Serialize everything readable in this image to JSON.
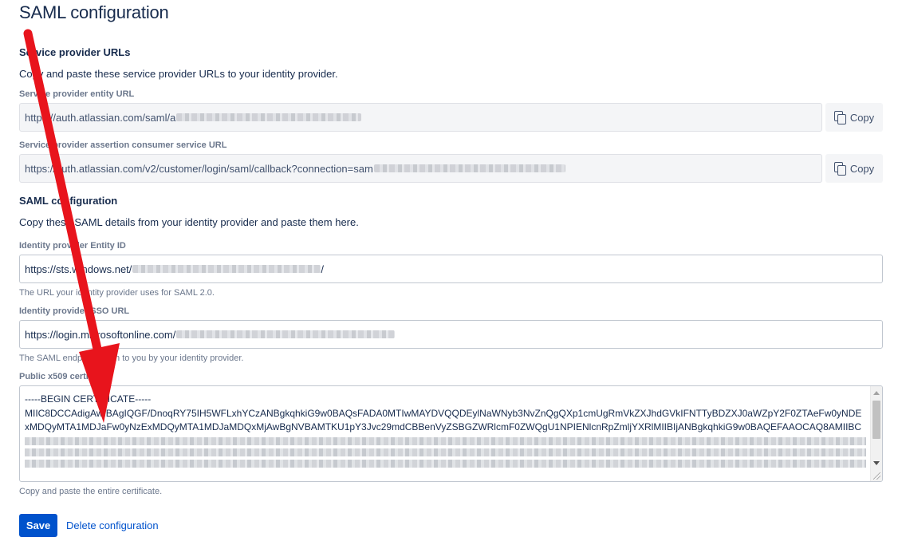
{
  "page": {
    "title": "SAML configuration"
  },
  "service_provider": {
    "heading": "Service provider URLs",
    "description": "Copy and paste these service provider URLs to your identity provider.",
    "entity_url": {
      "label": "Service provider entity URL",
      "value": "https://auth.atlassian.com/saml/a",
      "copy_label": "Copy"
    },
    "acs_url": {
      "label": "Service provider assertion consumer service URL",
      "value": "https://auth.atlassian.com/v2/customer/login/saml/callback?connection=sam",
      "copy_label": "Copy"
    }
  },
  "saml": {
    "heading": "SAML configuration",
    "description": "Copy these SAML details from your identity provider and paste them here.",
    "entity_id": {
      "label": "Identity provider Entity ID",
      "value": "https://sts.windows.net/",
      "suffix": "/",
      "helper": "The URL your identity provider uses for SAML 2.0."
    },
    "sso_url": {
      "label": "Identity provider SSO URL",
      "value": "https://login.microsoftonline.com/",
      "helper": "The SAML endpoint given to you by your identity provider."
    },
    "certificate": {
      "label": "Public x509 certificate",
      "lines": [
        "-----BEGIN CERTIFICATE-----",
        "MIIC8DCCAdigAwIBAgIQGF/DnoqRY75IH5WFLxhYCzANBgkqhkiG9w0BAQsFADA0MTIwMAYDVQQDEylNaWNyb3NvZnQgQXp1cmUgRmVkZXJhdGVkIFNTTyBDZXJ0aWZpY2F0ZTAeFw0yNDE",
        "xMDQyMTA1MDJaFw0yNzExMDQyMTA1MDJaMDQxMjAwBgNVBAMTKU1pY3Jvc29mdCBBenVyZSBGZWRlcmF0ZWQgU1NPIENlcnRpZmljYXRlMIIBIjANBgkqhkiG9w0BAQEFAAOCAQ8AMIIBC"
      ],
      "helper": "Copy and paste the entire certificate."
    }
  },
  "actions": {
    "save_label": "Save",
    "delete_label": "Delete configuration"
  },
  "colors": {
    "primary": "#0052cc",
    "annotation_arrow": "#e8141c"
  }
}
